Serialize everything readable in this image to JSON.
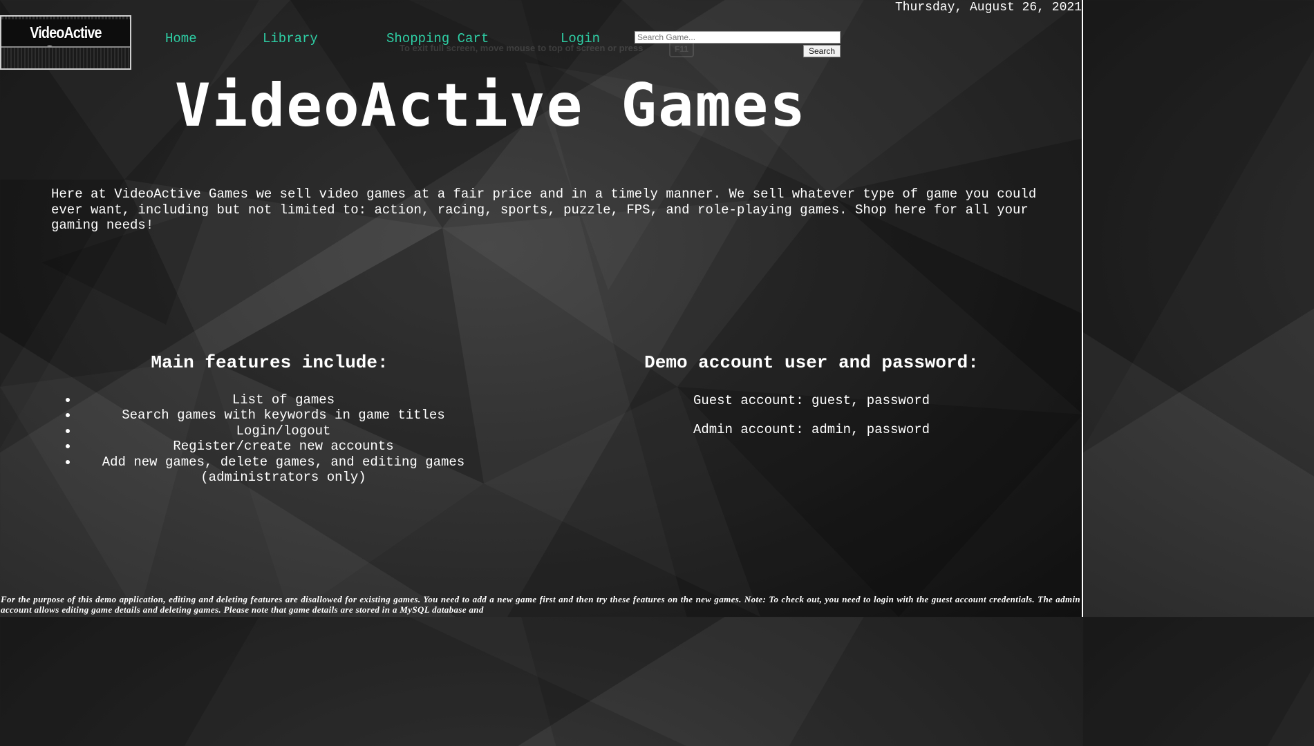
{
  "date": "Thursday, August 26, 2021",
  "logo": {
    "text": "VideoActive Games"
  },
  "nav": {
    "home": "Home",
    "library": "Library",
    "cart": "Shopping Cart",
    "login": "Login"
  },
  "search": {
    "placeholder": "Search Game...",
    "value": "",
    "button_label": "Search"
  },
  "fullscreen_hint": {
    "text": "To exit full screen, move mouse to top of screen or press",
    "key": "F11"
  },
  "page_title": "VideoActive Games",
  "intro": "Here at VideoActive Games we sell video games at a fair price and in a timely manner. We sell whatever type of game you could ever want, including but not limited to: action, racing, sports, puzzle, FPS, and role-playing games. Shop here for all your gaming needs!",
  "features": {
    "heading": "Main features include:",
    "items": [
      "List of games",
      "Search games with keywords in game titles",
      "Login/logout",
      "Register/create new accounts",
      "Add new games, delete games, and editing games (administrators only)"
    ]
  },
  "demo": {
    "heading": "Demo account user and password:",
    "guest": "Guest account: guest, password",
    "admin": "Admin account: admin, password"
  },
  "footer_note": "For the purpose of this demo application, editing and deleting features are disallowed for existing games. You need to add a new game first and then try these features on the new games. Note: To check out, you need to login with the guest account credentials. The admin account allows editing game details and deleting games. Please note that game details are stored in a MySQL database and",
  "colors": {
    "nav_link": "#2ecfa5",
    "text": "#ffffff",
    "background": "#262626"
  }
}
